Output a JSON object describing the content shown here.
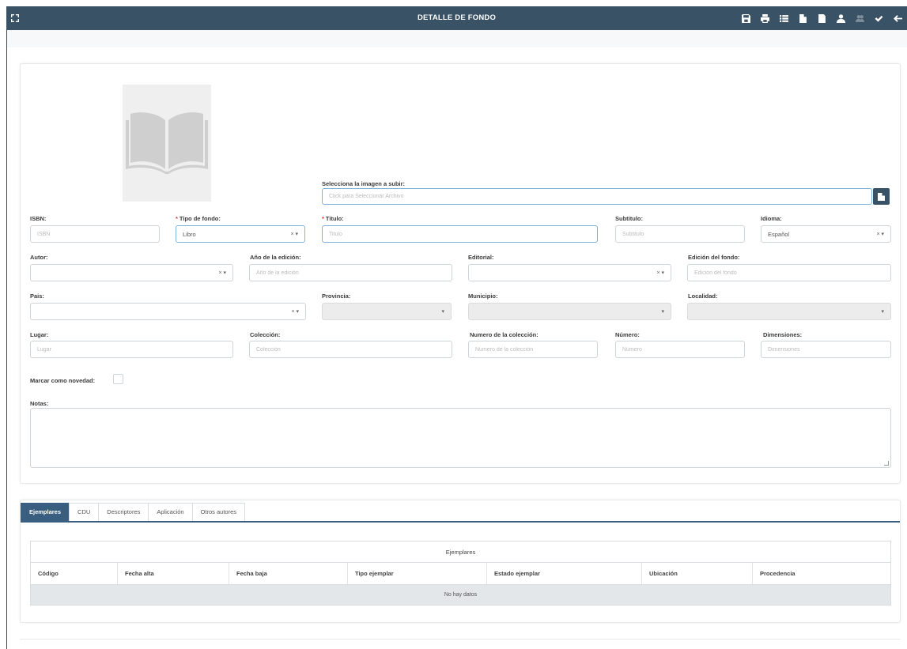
{
  "header": {
    "title": "DETALLE DE FONDO",
    "expand_icon": "expand-icon",
    "toolbar": [
      {
        "name": "save-icon",
        "enabled": true
      },
      {
        "name": "print-icon",
        "enabled": true
      },
      {
        "name": "list-icon",
        "enabled": true
      },
      {
        "name": "document-icon",
        "enabled": true
      },
      {
        "name": "edit-document-icon",
        "enabled": true
      },
      {
        "name": "user-icon",
        "enabled": true
      },
      {
        "name": "users-icon",
        "enabled": false
      },
      {
        "name": "check-icon",
        "enabled": true
      },
      {
        "name": "back-arrow-icon",
        "enabled": true
      }
    ],
    "bar_color": "#3a5266"
  },
  "form": {
    "image_upload": {
      "label": "Selecciona la imagen a subir:",
      "placeholder": "Click para Seleccionar Archivo"
    },
    "isbn": {
      "label": "ISBN:",
      "placeholder": "ISBN"
    },
    "tipo_fondo": {
      "label": "Tipo de fondo:",
      "value": "Libro",
      "clear": "× ▾"
    },
    "titulo": {
      "label": "Titulo:",
      "placeholder": "Titulo"
    },
    "subtitulo": {
      "label": "Subtitulo:",
      "placeholder": "Subtitulo"
    },
    "idioma": {
      "label": "Idioma:",
      "value": "Español",
      "clear": "× ▾"
    },
    "autor": {
      "label": "Autor:",
      "value": "",
      "clear": "× ▾"
    },
    "anio_edicion": {
      "label": "Año de la edición:",
      "placeholder": "Año de la edición"
    },
    "editorial": {
      "label": "Editorial:",
      "value": "",
      "clear": "× ▾"
    },
    "edicion_fondo": {
      "label": "Edición del fondo:",
      "placeholder": "Edición del fondo"
    },
    "pais": {
      "label": "Pais:",
      "value": "",
      "clear": "× ▾"
    },
    "provincia": {
      "label": "Provincia:",
      "value": "",
      "arrow": "▾"
    },
    "municipio": {
      "label": "Municipio:",
      "value": "",
      "arrow": "▾"
    },
    "localidad": {
      "label": "Localidad:",
      "value": "",
      "arrow": "▾"
    },
    "lugar": {
      "label": "Lugar:",
      "placeholder": "Lugar"
    },
    "coleccion": {
      "label": "Colección:",
      "placeholder": "Colección"
    },
    "numero_coleccion": {
      "label": "Numero de la colección:",
      "placeholder": "Numero de la colección"
    },
    "numero": {
      "label": "Número:",
      "placeholder": "Número"
    },
    "dimensiones": {
      "label": "Dimensiones:",
      "placeholder": "Dimensiones"
    },
    "novedad": {
      "label": "Marcar como novedad:",
      "checked": false
    },
    "notas": {
      "label": "Notas:"
    },
    "required_mark": "*"
  },
  "tabs": [
    {
      "label": "Ejemplares",
      "active": true
    },
    {
      "label": "CDU",
      "active": false
    },
    {
      "label": "Descriptores",
      "active": false
    },
    {
      "label": "Aplicación",
      "active": false
    },
    {
      "label": "Otros autores",
      "active": false
    }
  ],
  "grid": {
    "caption": "Ejemplares",
    "columns": [
      "Código",
      "Fecha alta",
      "Fecha baja",
      "Tipo ejemplar",
      "Estado ejemplar",
      "Ubicación",
      "Procedencia"
    ],
    "empty_text": "No hay datos"
  }
}
